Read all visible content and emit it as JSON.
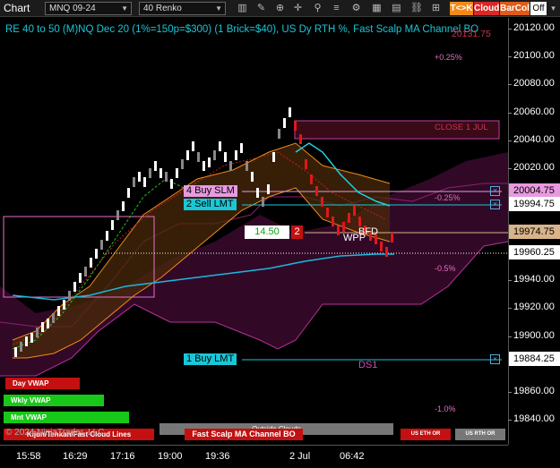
{
  "toolbar": {
    "title": "Chart",
    "instrument": "MNQ 09-24",
    "bar_type": "40 Renko",
    "btn_tk": "T<>K",
    "btn_cloud": "Cloud",
    "btn_barcol": "BarCol",
    "btn_off": "Off",
    "colors": {
      "tk": "#f08a1a",
      "cloud": "#d82828",
      "barcol": "#e05a1a"
    }
  },
  "chart": {
    "title": "RE 40 to 50 (M)NQ Dec 20 (1%=150p=$300) (1 Brick=$40), US Dy RTH %, Fast Scalp MA Channel BO",
    "title_overlay_value": "20131.75",
    "pct_labels": {
      "p025": "+0.25%",
      "m025": "-0.25%",
      "m05": "-0.5%",
      "m10": "-1.0%"
    },
    "close_label": "CLOSE 1 JUL",
    "orders": {
      "buy_slm": "4 Buy SLM",
      "sell_lmt": "2 Sell LMT",
      "buy_lmt": "1 Buy LMT",
      "close_x": "×"
    },
    "position": {
      "pnl": "14.50",
      "qty": "2"
    },
    "labels": {
      "wpp": "WPP",
      "bfd": "BFD",
      "ds1": "DS1"
    },
    "vwap": {
      "day": "Day VWAP",
      "wkly": "Wkly VWAP",
      "mnt": "Mnt VWAP"
    },
    "bottom": {
      "kijun": "Kijun/Tenkan/Fast Cloud Lines",
      "outside_clouds": "Outside Clouds",
      "fast_scalp": "Fast Scalp MA Channel BO",
      "us_eth": "US ETH OR",
      "us_rth": "US RTH OR"
    },
    "copyright": "© 2024 NinjaTrader, LLC"
  },
  "yaxis": {
    "ticks": [
      "20120.00",
      "20100.00",
      "20080.00",
      "20060.00",
      "20040.00",
      "20020.00",
      "19940.00",
      "19920.00",
      "19900.00",
      "19860.00",
      "19840.00"
    ],
    "price_labels": {
      "buy_slm": "20004.75",
      "sell_lmt": "19994.75",
      "last": "19974.75",
      "vwap": "19960.25",
      "buy_lmt": "19884.25"
    }
  },
  "xaxis": {
    "ticks": [
      "15:58",
      "16:29",
      "17:16",
      "19:00",
      "19:36",
      "2 Jul",
      "06:42"
    ]
  }
}
